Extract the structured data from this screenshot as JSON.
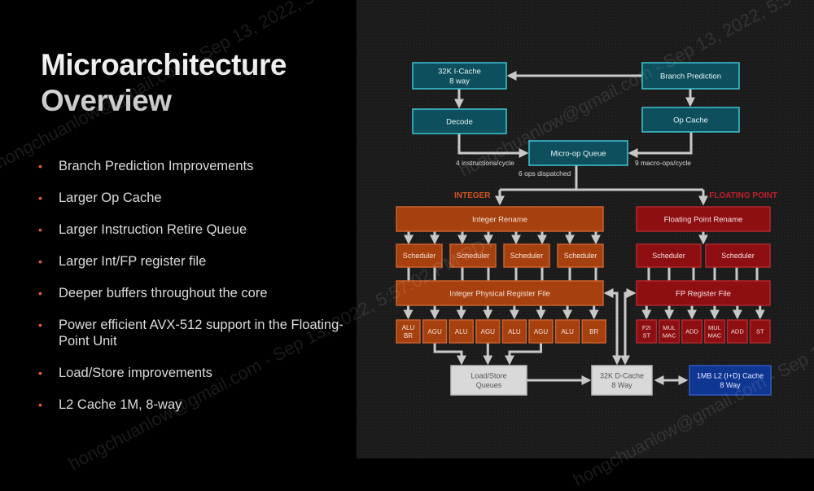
{
  "slide": {
    "title_line1": "Microarchitecture",
    "title_line2": "Overview",
    "bullets": [
      "Branch Prediction Improvements",
      "Larger Op Cache",
      "Larger Instruction Retire Queue",
      "Larger Int/FP register file",
      "Deeper buffers throughout the core",
      "Power efficient AVX-512 support in the Floating-Point Unit",
      "Load/Store improvements",
      "L2 Cache 1M, 8-way"
    ],
    "bullet_color": "#e0603a"
  },
  "diagram": {
    "colors": {
      "frontend_fill": "#0d4f5c",
      "frontend_border": "#3fc6d6",
      "integer_fill": "#a7400f",
      "integer_border": "#c9622f",
      "fp_fill": "#8d0f12",
      "fp_border": "#b0282c",
      "memory_fill": "#d9d9d9",
      "l2_fill": "#0f3691",
      "arrow": "#c8c8c8",
      "integer_label": "#d0541f",
      "fp_label": "#c0202a"
    },
    "frontend": {
      "icache": [
        "32K I-Cache",
        "8 way"
      ],
      "branch_prediction": "Branch Prediction",
      "decode": "Decode",
      "op_cache": "Op Cache",
      "micro_op_queue": "Micro-op Queue",
      "decode_rate": "4 instructions/cycle",
      "opcache_rate": "9 macro-ops/cycle",
      "dispatch_rate": "6 ops dispatched"
    },
    "integer": {
      "section_label": "INTEGER",
      "rename": "Integer Rename",
      "schedulers": [
        "Scheduler",
        "Scheduler",
        "Scheduler",
        "Scheduler"
      ],
      "register_file": "Integer Physical Register File",
      "units": [
        [
          "ALU",
          "BR"
        ],
        [
          "AGU"
        ],
        [
          "ALU"
        ],
        [
          "AGU"
        ],
        [
          "ALU"
        ],
        [
          "AGU"
        ],
        [
          "ALU"
        ],
        [
          "BR"
        ]
      ]
    },
    "fp": {
      "section_label": "FLOATING POINT",
      "rename": "Floating Point Rename",
      "schedulers": [
        "Scheduler",
        "Scheduler"
      ],
      "register_file": "FP Register File",
      "units": [
        [
          "F2I",
          "ST"
        ],
        [
          "MUL",
          "MAC"
        ],
        [
          "ADD"
        ],
        [
          "MUL",
          "MAC"
        ],
        [
          "ADD"
        ],
        [
          "ST"
        ]
      ]
    },
    "memory": {
      "load_store": [
        "Load/Store",
        "Queues"
      ],
      "dcache": [
        "32K D-Cache",
        "8 Way"
      ],
      "l2": [
        "1MB L2 (I+D) Cache",
        "8 Way"
      ]
    }
  },
  "watermarks": [
    "hongchuanlow@gmail.com - Sep 13, 2022, 5:57:02 PM PDT"
  ]
}
